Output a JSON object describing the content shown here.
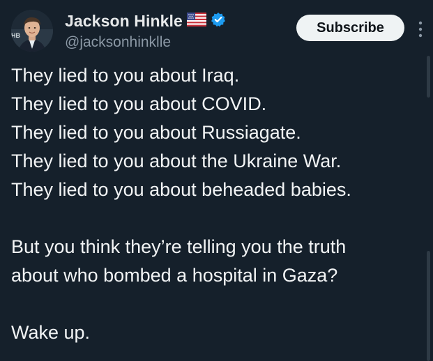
{
  "post": {
    "author": {
      "display_name": "Jackson Hinkle",
      "handle": "@jacksonhinklle",
      "flag_icon": "us-flag-icon",
      "verified_icon": "verified-badge-icon",
      "verified_color": "#1d9bf0"
    },
    "subscribe_label": "Subscribe",
    "more_icon": "more-vertical-icon",
    "paragraphs": [
      [
        "They lied to you about Iraq.",
        "They lied to you about COVID.",
        "They lied to you about Russiagate.",
        "They lied to you about the Ukraine War.",
        "They lied to you about beheaded babies."
      ],
      [
        "But you think they’re telling you the truth",
        "about who bombed a hospital in Gaza?"
      ],
      [
        "Wake up."
      ]
    ]
  },
  "colors": {
    "background": "#15202b",
    "text": "#e7e9ea",
    "secondary_text": "#8b98a5",
    "button_bg": "#eff3f4"
  }
}
